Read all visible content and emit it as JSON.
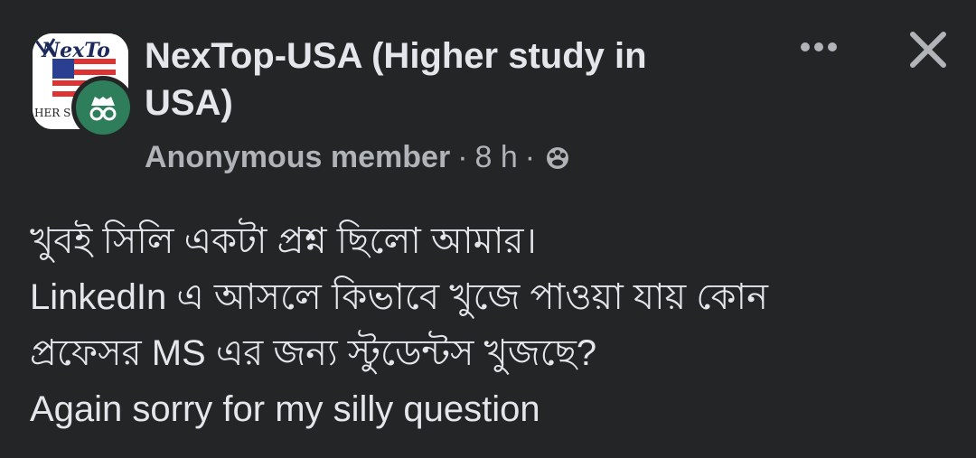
{
  "group": {
    "name": "NexTop-USA (Higher study in USA)",
    "avatar_icon": "nextop-usa-logo",
    "avatar_text_top": "NexTo",
    "avatar_text_bottom": "HER S"
  },
  "post_meta": {
    "author": "Anonymous member",
    "separator": "·",
    "time": "8 h",
    "privacy_icon": "group-privacy-icon",
    "badge_icon": "anonymous-member-icon"
  },
  "actions": {
    "more_icon": "more-options-icon",
    "close_icon": "close-icon"
  },
  "post": {
    "lines": [
      "খুবই সিলি একটা প্রশ্ন ছিলো আমার।",
      "LinkedIn এ আসলে কিভাবে খুজে পাওয়া যায় কোন",
      "প্রফেসর MS এর জন্য স্টুডেন্টস খুজছে?",
      "Again sorry for my silly question"
    ]
  },
  "colors": {
    "background": "#242526",
    "primary_text": "#e4e6eb",
    "secondary_text": "#b0b3b8",
    "badge_green": "#2e7d5b"
  }
}
